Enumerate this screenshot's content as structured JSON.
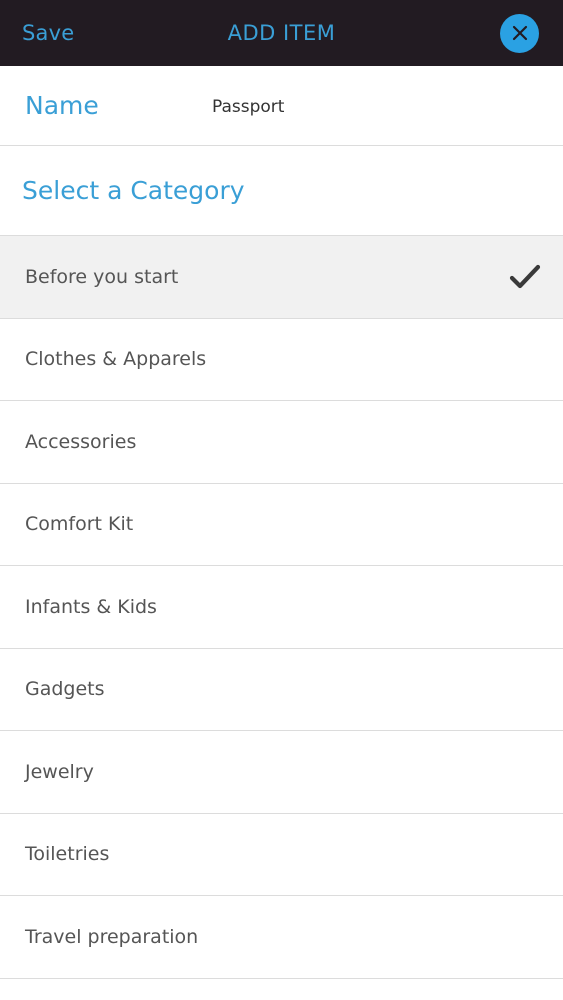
{
  "header": {
    "save_label": "Save",
    "title": "ADD ITEM",
    "close_icon": "close-icon"
  },
  "name_field": {
    "label": "Name",
    "value": "Passport"
  },
  "category": {
    "heading": "Select a Category",
    "items": [
      {
        "label": "Before you start",
        "selected": true
      },
      {
        "label": "Clothes & Apparels",
        "selected": false
      },
      {
        "label": "Accessories",
        "selected": false
      },
      {
        "label": "Comfort Kit",
        "selected": false
      },
      {
        "label": "Infants & Kids",
        "selected": false
      },
      {
        "label": "Gadgets",
        "selected": false
      },
      {
        "label": "Jewelry",
        "selected": false
      },
      {
        "label": "Toiletries",
        "selected": false
      },
      {
        "label": "Travel preparation",
        "selected": false
      }
    ]
  },
  "colors": {
    "topbar": "#221b22",
    "accent": "#3a9fd6",
    "close_button": "#2aa1e3",
    "selected_row": "#f1f1f1"
  }
}
